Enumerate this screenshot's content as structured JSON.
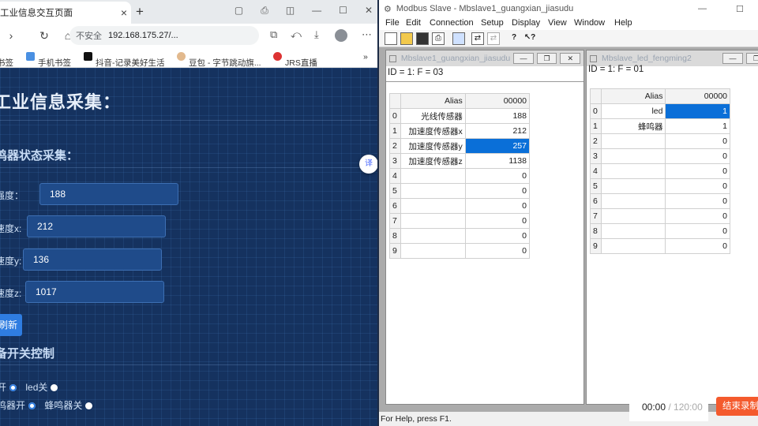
{
  "browser": {
    "tab_title": "工业信息交互页面",
    "close_icon": "close-icon",
    "url_warning": "不安全",
    "url": "192.168.175.27/...",
    "bookmarks": [
      "书签",
      "手机书签",
      "抖音-记录美好生活",
      "豆包 - 字节跳动旗...",
      "JRS直播"
    ],
    "bookmarks_more": "»"
  },
  "page": {
    "title": "工业信息采集：",
    "section1": "鸣器状态采集：",
    "labels": [
      "强度：",
      "速度x:",
      "速度y:",
      "速度z:"
    ],
    "values": [
      "188",
      "212",
      "136",
      "1017"
    ],
    "refresh": "刷新",
    "section2": "备开关控制",
    "led_on": "开",
    "led_off": "led关",
    "buzzer_on": "鸣器开",
    "buzzer_off": "蜂鸣器关"
  },
  "modbus": {
    "title": "Modbus Slave - Mbslave1_guangxian_jiasudu",
    "menu": [
      "File",
      "Edit",
      "Connection",
      "Setup",
      "Display",
      "View",
      "Window",
      "Help"
    ],
    "win1": {
      "title": "Mbslave1_guangxian_jiasudu",
      "id_line": "ID = 1: F = 03",
      "col_alias": "Alias",
      "col_addr": "00000",
      "rows": [
        {
          "n": "0",
          "alias": "光线传感器",
          "val": "188"
        },
        {
          "n": "1",
          "alias": "加速度传感器x",
          "val": "212"
        },
        {
          "n": "2",
          "alias": "加速度传感器y",
          "val": "257"
        },
        {
          "n": "3",
          "alias": "加速度传感器z",
          "val": "1138"
        },
        {
          "n": "4",
          "alias": "",
          "val": "0"
        },
        {
          "n": "5",
          "alias": "",
          "val": "0"
        },
        {
          "n": "6",
          "alias": "",
          "val": "0"
        },
        {
          "n": "7",
          "alias": "",
          "val": "0"
        },
        {
          "n": "8",
          "alias": "",
          "val": "0"
        },
        {
          "n": "9",
          "alias": "",
          "val": "0"
        }
      ]
    },
    "win2": {
      "title": "Mbslave_led_fengming2",
      "id_line": "ID = 1: F = 01",
      "col_alias": "Alias",
      "col_addr": "00000",
      "rows": [
        {
          "n": "0",
          "alias": "led",
          "val": "1"
        },
        {
          "n": "1",
          "alias": "蜂鸣器",
          "val": "1"
        },
        {
          "n": "2",
          "alias": "",
          "val": "0"
        },
        {
          "n": "3",
          "alias": "",
          "val": "0"
        },
        {
          "n": "4",
          "alias": "",
          "val": "0"
        },
        {
          "n": "5",
          "alias": "",
          "val": "0"
        },
        {
          "n": "6",
          "alias": "",
          "val": "0"
        },
        {
          "n": "7",
          "alias": "",
          "val": "0"
        },
        {
          "n": "8",
          "alias": "",
          "val": "0"
        },
        {
          "n": "9",
          "alias": "",
          "val": "0"
        }
      ]
    },
    "status": "For Help, press F1."
  },
  "recorder": {
    "elapsed": "00:00",
    "separator": " / ",
    "total": "120:00",
    "stop": "结束录制"
  }
}
